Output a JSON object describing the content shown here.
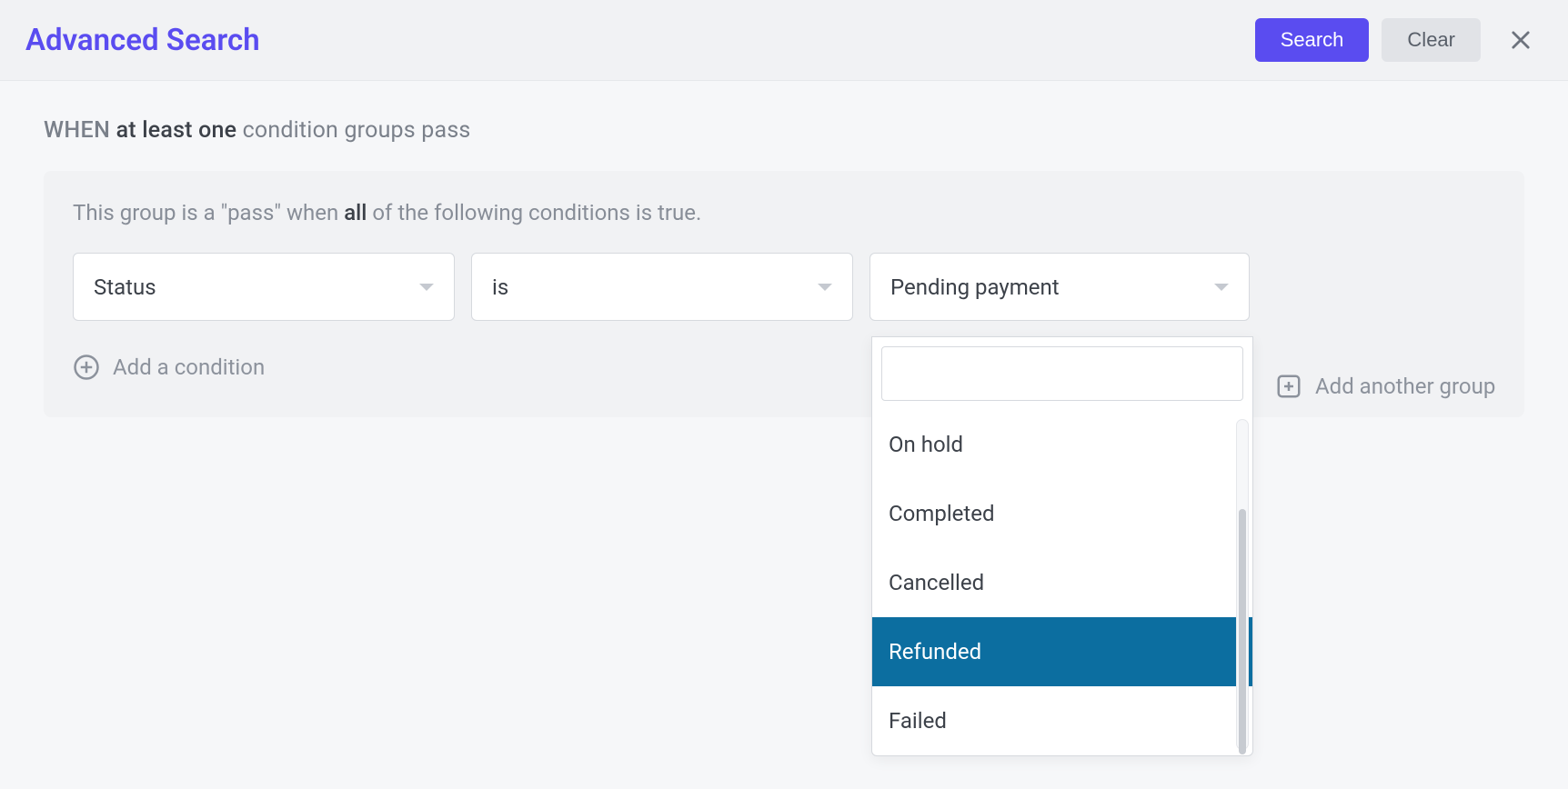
{
  "header": {
    "title": "Advanced Search",
    "search_label": "Search",
    "clear_label": "Clear"
  },
  "when_line": {
    "prefix": "WHEN",
    "mode": "at least one",
    "suffix": "condition groups pass"
  },
  "group": {
    "desc_prefix": "This group is a \"pass\" when",
    "desc_mode": "all",
    "desc_suffix": "of the following conditions is true."
  },
  "condition": {
    "field": "Status",
    "operator": "is",
    "value": "Pending payment"
  },
  "actions": {
    "add_condition": "Add a condition",
    "add_group": "Add another group"
  },
  "dropdown": {
    "search_value": "",
    "options": [
      {
        "label": "On hold",
        "highlighted": false
      },
      {
        "label": "Completed",
        "highlighted": false
      },
      {
        "label": "Cancelled",
        "highlighted": false
      },
      {
        "label": "Refunded",
        "highlighted": true
      },
      {
        "label": "Failed",
        "highlighted": false
      }
    ]
  }
}
